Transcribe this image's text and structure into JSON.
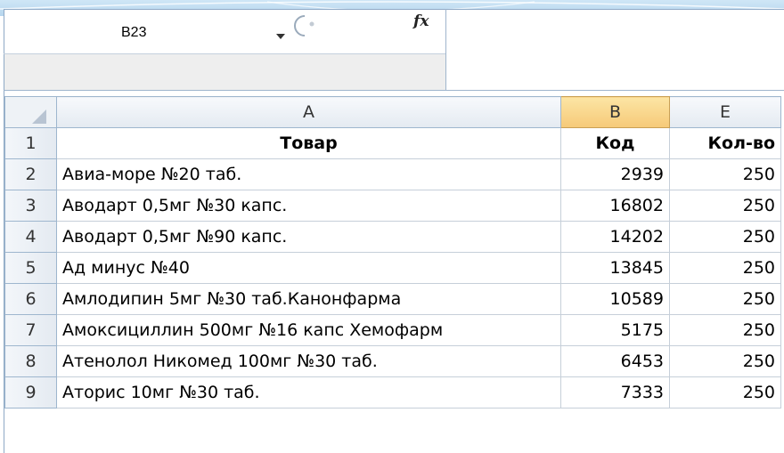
{
  "name_box": {
    "value": "B23",
    "dropdown_icon": "chevron-down-icon"
  },
  "formula_bar": {
    "fx_icon": "function-icon",
    "fx_label": "fx",
    "value": ""
  },
  "columns": [
    "A",
    "B",
    "E"
  ],
  "selected_column": "B",
  "rows": [
    {
      "num": "1",
      "a": "Товар",
      "b": "Код",
      "e": "Кол-во",
      "header": true
    },
    {
      "num": "2",
      "a": "Авиа-море №20 таб.",
      "b": "2939",
      "e": "250"
    },
    {
      "num": "3",
      "a": "Аводарт 0,5мг №30 капс.",
      "b": "16802",
      "e": "250"
    },
    {
      "num": "4",
      "a": "Аводарт 0,5мг №90 капс.",
      "b": "14202",
      "e": "250"
    },
    {
      "num": "5",
      "a": "Ад минус №40",
      "b": "13845",
      "e": "250"
    },
    {
      "num": "6",
      "a": "Амлодипин 5мг №30 таб.Канонфарма",
      "b": "10589",
      "e": "250"
    },
    {
      "num": "7",
      "a": "Амоксициллин 500мг №16 капс Хемофарм",
      "b": "5175",
      "e": "250"
    },
    {
      "num": "8",
      "a": "Атенолол Никомед 100мг №30 таб.",
      "b": "6453",
      "e": "250"
    },
    {
      "num": "9",
      "a": "Аторис 10мг №30 таб.",
      "b": "7333",
      "e": "250"
    }
  ],
  "colors": {
    "selected_header": "#f6c978",
    "grid_line": "#c6cfd9",
    "header_bg": "#e4eaf1"
  }
}
